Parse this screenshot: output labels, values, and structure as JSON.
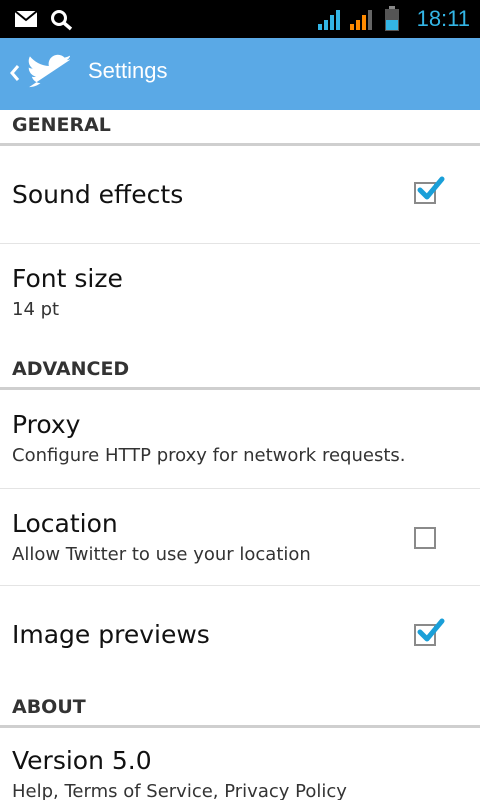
{
  "status_bar": {
    "icons": [
      "mail-icon",
      "search-icon",
      "signal-icon",
      "signal-icon-2",
      "battery-icon"
    ],
    "time": "18:11"
  },
  "app_bar": {
    "title": "Settings"
  },
  "sections": {
    "general": {
      "header": "GENERAL",
      "sound_effects": {
        "title": "Sound effects",
        "checked": true
      },
      "font_size": {
        "title": "Font size",
        "subtitle": "14 pt"
      }
    },
    "advanced": {
      "header": "ADVANCED",
      "proxy": {
        "title": "Proxy",
        "subtitle": "Configure HTTP proxy for network requests."
      },
      "location": {
        "title": "Location",
        "subtitle": "Allow Twitter to use your location",
        "checked": false
      },
      "image_previews": {
        "title": "Image previews",
        "checked": true
      }
    },
    "about": {
      "header": "ABOUT",
      "version": {
        "title": "Version 5.0",
        "subtitle": "Help, Terms of Service, Privacy Policy"
      }
    }
  },
  "colors": {
    "app_bar": "#5aa9e6",
    "status_time": "#33b5e5",
    "checkmark": "#1a9fd8"
  }
}
